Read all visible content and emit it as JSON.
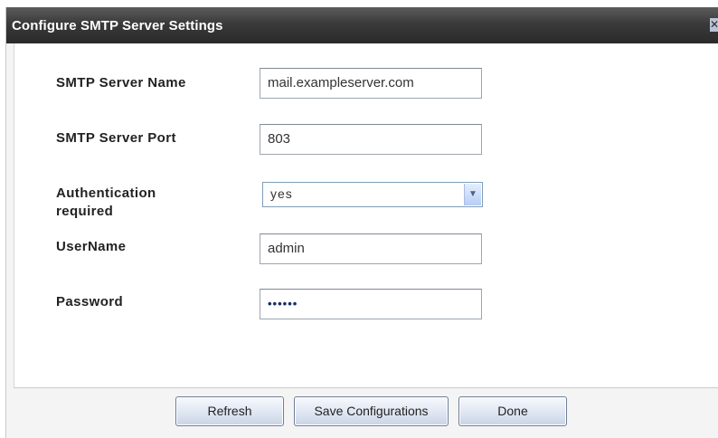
{
  "window": {
    "title": "Configure SMTP Server Settings",
    "close_glyph": "✕"
  },
  "form": {
    "smtp_server_name": {
      "label": "SMTP Server Name",
      "value": "mail.exampleserver.com"
    },
    "smtp_server_port": {
      "label": "SMTP Server Port",
      "value": "803"
    },
    "authentication": {
      "label_line1": "Authentication",
      "label_line2": "required",
      "selected": "yes",
      "arrow_glyph": "▼"
    },
    "username": {
      "label": "UserName",
      "value": "admin"
    },
    "password": {
      "label": "Password",
      "masked_value": "••••••"
    }
  },
  "buttons": {
    "refresh": "Refresh",
    "save": "Save Configurations",
    "done": "Done"
  },
  "colors": {
    "titlebar": "#3a3a3a",
    "button_border": "#6f7f96",
    "dropdown_arrow_bg": "#b8cdf6"
  }
}
